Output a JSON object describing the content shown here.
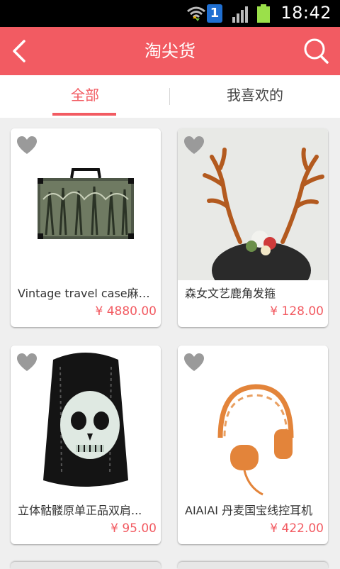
{
  "status": {
    "time": "18:42",
    "sim_number": "1"
  },
  "header": {
    "title": "淘尖货"
  },
  "tabs": [
    {
      "label": "全部",
      "active": true
    },
    {
      "label": "我喜欢的",
      "active": false
    }
  ],
  "products": [
    {
      "name": "Vintage travel case麻布...",
      "price": "¥ 4880.00",
      "image": "vintage-suitcase"
    },
    {
      "name": "森女文艺鹿角发箍",
      "price": "¥ 128.00",
      "image": "deer-antler-headband"
    },
    {
      "name": "立体骷髅原单正品双肩...",
      "price": "¥ 95.00",
      "image": "skull-backpack"
    },
    {
      "name": "AIAIAI 丹麦国宝线控耳机",
      "price": "¥ 422.00",
      "image": "orange-headphones"
    }
  ],
  "colors": {
    "accent": "#f25b62",
    "background": "#efefef",
    "heart": "#9a9a9a"
  }
}
